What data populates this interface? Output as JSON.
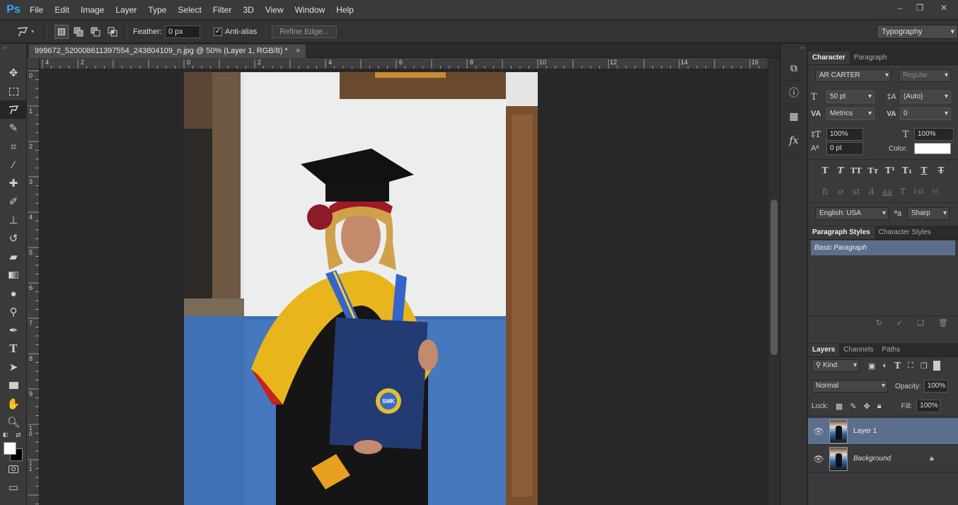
{
  "app": {
    "logo": "Ps"
  },
  "menu": [
    "File",
    "Edit",
    "Image",
    "Layer",
    "Type",
    "Select",
    "Filter",
    "3D",
    "View",
    "Window",
    "Help"
  ],
  "window_controls": {
    "minimize": "–",
    "restore": "❐",
    "close": "✕"
  },
  "options": {
    "feather_label": "Feather:",
    "feather_value": "0 px",
    "antialias_label": "Anti-alias",
    "antialias_checked": true,
    "refine_edge": "Refine Edge...",
    "workspace": "Typography"
  },
  "document": {
    "tab_title": "999672_520008611397554_243804109_n.jpg @ 50% (Layer 1, RGB/8) *",
    "close": "×"
  },
  "ruler": {
    "h_labels": [
      "4",
      "2",
      "0",
      "2",
      "4",
      "6",
      "8",
      "10",
      "12",
      "14",
      "16"
    ],
    "v_labels": [
      "0",
      "1",
      "2",
      "3",
      "4",
      "5",
      "6",
      "7",
      "8",
      "9",
      "1 0",
      "1 1"
    ]
  },
  "photo": {
    "label_text": "SMK"
  },
  "character": {
    "tab_character": "Character",
    "tab_paragraph": "Paragraph",
    "font_family": "AR CARTER",
    "font_style": "Regular",
    "font_size": "50 pt",
    "leading": "(Auto)",
    "kerning": "Metrics",
    "tracking": "0",
    "vertical_scale": "100%",
    "horizontal_scale": "100%",
    "baseline_shift": "0 pt",
    "color_label": "Color:",
    "color": "#ffffff",
    "language": "English: USA",
    "aa_label": "ªa",
    "antialias": "Sharp"
  },
  "paragraph_styles": {
    "tab_paragraph_styles": "Paragraph Styles",
    "tab_character_styles": "Character Styles",
    "items": [
      "Basic Paragraph"
    ]
  },
  "layers": {
    "tab_layers": "Layers",
    "tab_channels": "Channels",
    "tab_paths": "Paths",
    "filter_kind": "Kind",
    "blend_mode": "Normal",
    "opacity_label": "Opacity:",
    "opacity": "100%",
    "lock_label": "Lock:",
    "fill_label": "Fill:",
    "fill": "100%",
    "items": [
      {
        "name": "Layer 1",
        "selected": true,
        "locked": false
      },
      {
        "name": "Background",
        "selected": false,
        "locked": true
      }
    ]
  },
  "colors": {
    "accent_selection": "#5b6f8c",
    "ps_blue": "#31a8ff"
  }
}
